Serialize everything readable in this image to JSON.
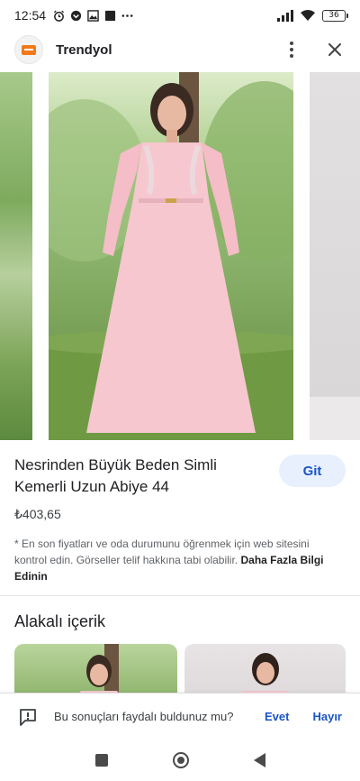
{
  "status_bar": {
    "time": "12:54",
    "battery": "36",
    "icons": [
      "alarm-icon",
      "media-icon",
      "image-icon",
      "app-icon",
      "more-notifications-icon",
      "signal-icon",
      "wifi-icon",
      "battery-icon"
    ]
  },
  "app_bar": {
    "site_name": "Trendyol",
    "logo_icon": "trendyol-logo-icon",
    "brand_color": "#f27a1a",
    "more_icon": "more-vert-icon",
    "close_icon": "close-icon"
  },
  "product": {
    "title": "Nesrinden Büyük Beden Simli Kemerli Uzun Abiye 44",
    "price": "₺403,65",
    "go_label": "Git",
    "disclaimer": "* En son fiyatları ve oda durumunu öğrenmek için web sitesini kontrol edin. Görseller telif hakkına tabi olabilir.",
    "learn_more": "Daha Fazla Bilgi Edinin"
  },
  "related": {
    "heading": "Alakalı içerik"
  },
  "feedback": {
    "question": "Bu sonuçları faydalı buldunuz mu?",
    "yes": "Evet",
    "no": "Hayır",
    "icon": "feedback-icon"
  },
  "nav": {
    "recents_icon": "recents-square-icon",
    "home_icon": "home-circle-icon",
    "back_icon": "back-triangle-icon"
  },
  "colors": {
    "accent": "#1a55c6",
    "button_bg": "#e8f0fe",
    "dress": "#f6c7cf"
  }
}
